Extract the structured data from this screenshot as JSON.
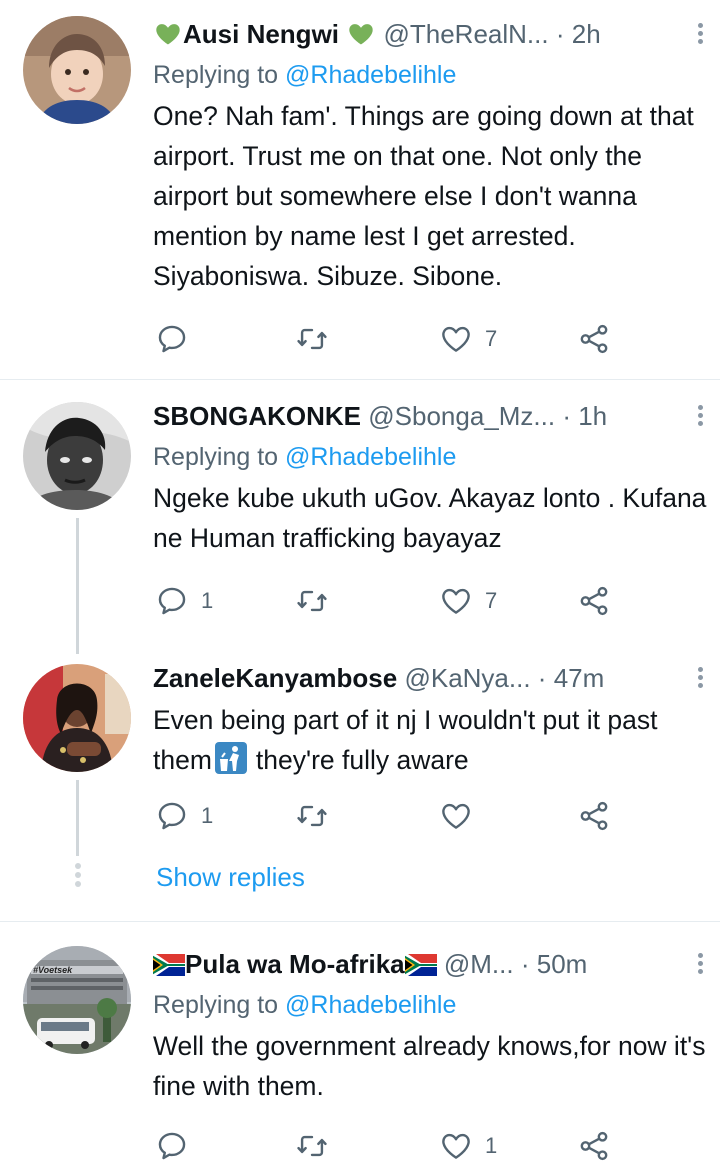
{
  "tweets": [
    {
      "name": "Ausi Nengwi",
      "handle": "@TheRealN...",
      "time": "2h",
      "replying_prefix": "Replying to",
      "replying_to": "@Rhadebelihle",
      "text": "One? Nah fam'. Things are going down at that airport. Trust me on that one. Not only the airport but somewhere else I don't wanna mention by name lest I get arrested. Siyaboniswa. Sibuze. Sibone.",
      "reply_count": "",
      "retweet_count": "",
      "like_count": "7"
    },
    {
      "name": "SBONGAKONKE",
      "handle": "@Sbonga_Mz...",
      "time": "1h",
      "replying_prefix": "Replying to",
      "replying_to": "@Rhadebelihle",
      "text": "Ngeke kube ukuth uGov. Akayaz lonto . Kufana ne Human trafficking bayayaz",
      "reply_count": "1",
      "retweet_count": "",
      "like_count": "7"
    },
    {
      "name": "ZaneleKanyambose",
      "handle": "@KaNya...",
      "time": "47m",
      "text_before": "Even being part of it nj I wouldn't put it past them",
      "text_after": "they're fully aware",
      "reply_count": "1",
      "retweet_count": "",
      "like_count": ""
    },
    {
      "name": "Pula wa Mo-afrika",
      "handle": "@M...",
      "time": "50m",
      "replying_prefix": "Replying to",
      "replying_to": "@Rhadebelihle",
      "text": "Well the government already knows,for now it's fine with them.",
      "reply_count": "",
      "retweet_count": "",
      "like_count": "1"
    }
  ],
  "show_replies": "Show replies",
  "separator": "·",
  "colors": {
    "link": "#1d9bf0",
    "secondary": "#536471",
    "primary_text": "#0f1419",
    "green_heart": "#78b159"
  },
  "icons": {
    "reply": "reply-icon",
    "retweet": "retweet-icon",
    "like": "heart-icon",
    "share": "share-icon",
    "more": "more-vertical-icon"
  },
  "avatar_badge": "#Voetsek"
}
